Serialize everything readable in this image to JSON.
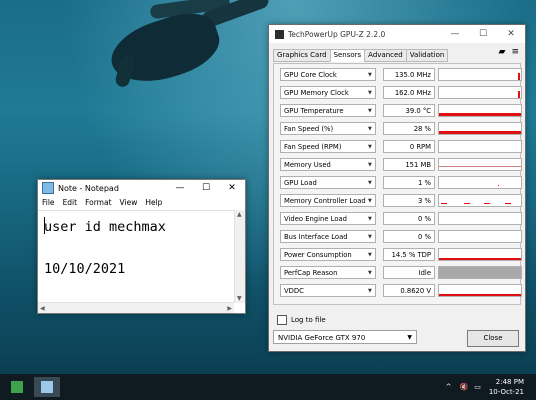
{
  "notepad": {
    "title": "Note - Notepad",
    "controls": {
      "min": "—",
      "max": "☐",
      "close": "✕"
    },
    "menu": [
      "File",
      "Edit",
      "Format",
      "View",
      "Help"
    ],
    "content": "user id mechmax\n\n10/10/2021"
  },
  "gpuz": {
    "title": "TechPowerUp GPU-Z 2.2.0",
    "controls": {
      "min": "—",
      "max": "☐",
      "close": "✕"
    },
    "tabs": [
      "Graphics Card",
      "Sensors",
      "Advanced",
      "Validation"
    ],
    "active_tab": "Sensors",
    "sensors": [
      {
        "label": "GPU Core Clock",
        "value": "135.0 MHz",
        "graph": "spike",
        "level": 0.6
      },
      {
        "label": "GPU Memory Clock",
        "value": "162.0 MHz",
        "graph": "spike",
        "level": 0.6
      },
      {
        "label": "GPU Temperature",
        "value": "39.0 °C",
        "graph": "fill",
        "level": 0.25
      },
      {
        "label": "Fan Speed (%)",
        "value": "28 %",
        "graph": "fill",
        "level": 0.3
      },
      {
        "label": "Fan Speed (RPM)",
        "value": "0 RPM",
        "graph": "empty",
        "level": 0
      },
      {
        "label": "Memory Used",
        "value": "151 MB",
        "graph": "line",
        "level": 0.05
      },
      {
        "label": "GPU Load",
        "value": "1 %",
        "graph": "dot",
        "level": 0.05
      },
      {
        "label": "Memory Controller Load",
        "value": "3 %",
        "graph": "dash",
        "level": 0.08
      },
      {
        "label": "Video Engine Load",
        "value": "0 %",
        "graph": "empty",
        "level": 0
      },
      {
        "label": "Bus Interface Load",
        "value": "0 %",
        "graph": "empty",
        "level": 0
      },
      {
        "label": "Power Consumption",
        "value": "14.5 % TDP",
        "graph": "fill",
        "level": 0.15
      },
      {
        "label": "PerfCap Reason",
        "value": "Idle",
        "graph": "gray",
        "level": 1
      },
      {
        "label": "VDDC",
        "value": "0.8620 V",
        "graph": "fill",
        "level": 0.15
      }
    ],
    "log_label": "Log to file",
    "gpu_name": "NVIDIA GeForce GTX 970",
    "close_label": "Close"
  },
  "taskbar": {
    "time": "2:48 PM",
    "date": "10-Oct-21"
  }
}
